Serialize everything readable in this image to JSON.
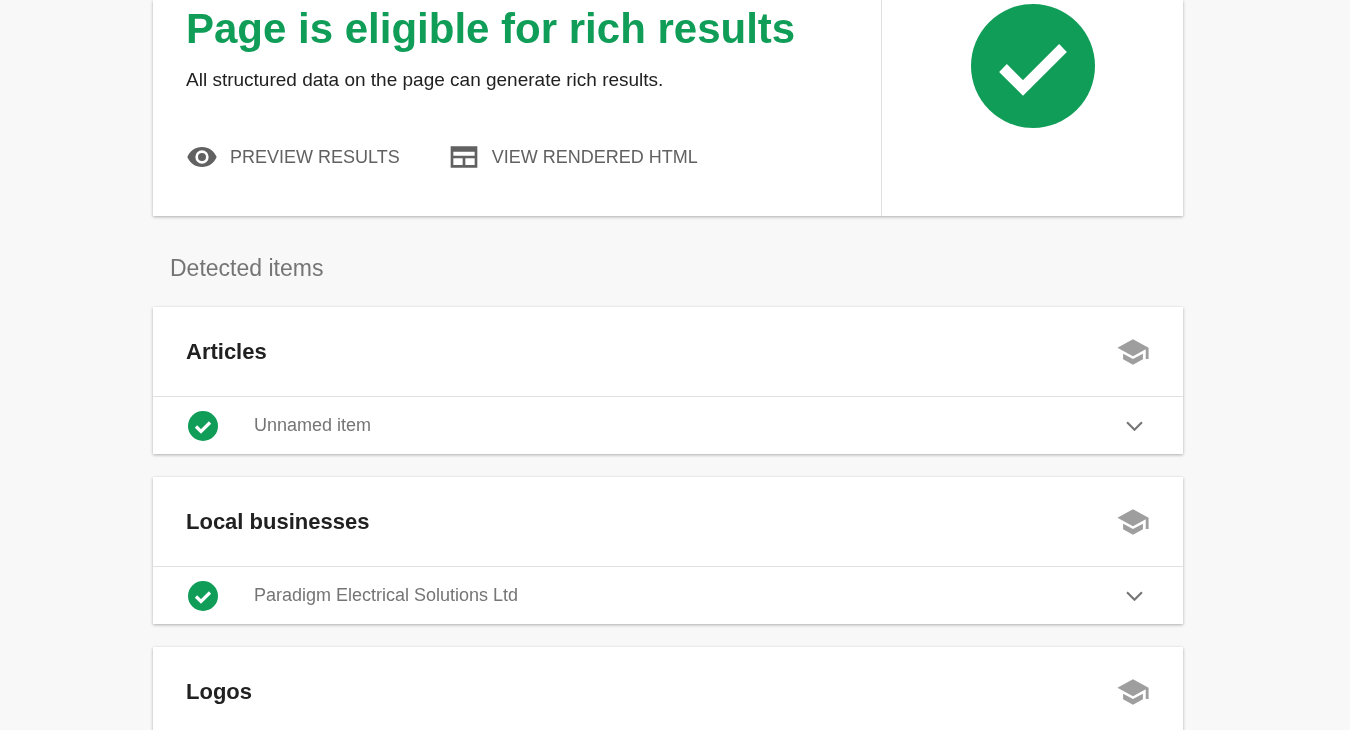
{
  "summary": {
    "title": "Page is eligible for rich results",
    "description": "All structured data on the page can generate rich results.",
    "actions": [
      {
        "label": "PREVIEW RESULTS",
        "kind": "preview"
      },
      {
        "label": "VIEW RENDERED HTML",
        "kind": "html"
      }
    ]
  },
  "detected_heading": "Detected items",
  "sections": [
    {
      "title": "Articles",
      "items": [
        {
          "name": "Unnamed item"
        }
      ]
    },
    {
      "title": "Local businesses",
      "items": [
        {
          "name": "Paradigm Electrical Solutions Ltd"
        }
      ]
    },
    {
      "title": "Logos"
    }
  ]
}
